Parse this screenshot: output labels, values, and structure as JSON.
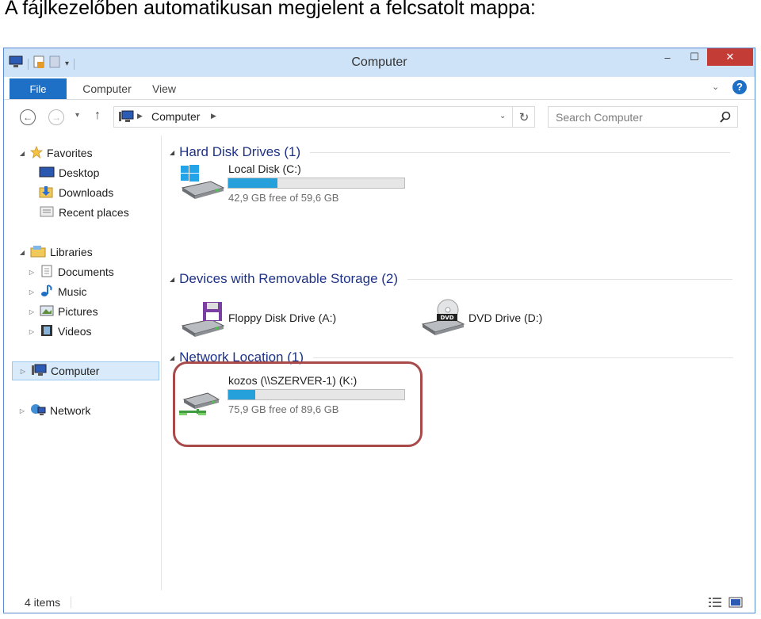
{
  "caption": "A fájlkezelőben automatikusan megjelent a felcsatolt mappa:",
  "window": {
    "title": "Computer",
    "controls": {
      "minimize": "–",
      "maximize": "☐",
      "close": "✕"
    }
  },
  "ribbon": {
    "tabs": [
      "File",
      "Computer",
      "View"
    ],
    "help": "?"
  },
  "navigation": {
    "address_path": [
      "Computer"
    ],
    "search_placeholder": "Search Computer"
  },
  "sidebar": {
    "favorites": {
      "label": "Favorites",
      "items": [
        "Desktop",
        "Downloads",
        "Recent places"
      ]
    },
    "libraries": {
      "label": "Libraries",
      "items": [
        "Documents",
        "Music",
        "Pictures",
        "Videos"
      ]
    },
    "computer": {
      "label": "Computer",
      "selected": true
    },
    "network": {
      "label": "Network"
    }
  },
  "groups": {
    "hard_disks": {
      "header": "Hard Disk Drives (1)",
      "drives": [
        {
          "name": "Local Disk (C:)",
          "free_text": "42,9 GB free of 59,6 GB",
          "used_fraction": 0.28,
          "icon": "windows-drive-icon"
        }
      ]
    },
    "removable": {
      "header": "Devices with Removable Storage (2)",
      "devices": [
        {
          "name": "Floppy Disk Drive (A:)",
          "icon": "floppy-drive-icon"
        },
        {
          "name": "DVD Drive (D:)",
          "icon": "dvd-drive-icon"
        }
      ]
    },
    "network": {
      "header": "Network Location (1)",
      "drives": [
        {
          "name": "kozos (\\\\SZERVER-1) (K:)",
          "free_text": "75,9 GB free of 89,6 GB",
          "used_fraction": 0.153,
          "icon": "network-drive-icon"
        }
      ]
    }
  },
  "status": {
    "item_count": "4 items"
  },
  "colors": {
    "titlebar": "#cfe3f8",
    "file_tab": "#1e6fc6",
    "close_button": "#c43c36",
    "group_header": "#1e3287",
    "progress_fill": "#26a0da",
    "highlight_border": "#a84a4a",
    "selection": "#d9ebfa"
  }
}
